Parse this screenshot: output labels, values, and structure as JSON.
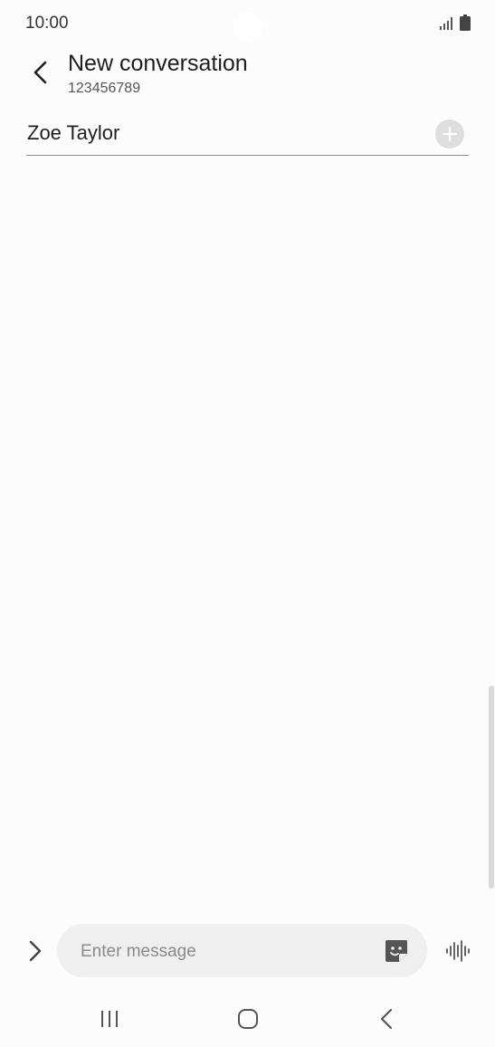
{
  "status_bar": {
    "time": "10:00",
    "signal_icon": "signal-icon",
    "battery_icon": "battery-icon"
  },
  "header": {
    "back_icon": "back-arrow-icon",
    "title": "New conversation",
    "subtitle": "123456789"
  },
  "recipient": {
    "name": "Zoe Taylor",
    "add_icon": "add-icon"
  },
  "composer": {
    "expand_icon": "chevron-right-icon",
    "message_placeholder": "Enter message",
    "message_value": "",
    "sticker_icon": "sticker-icon",
    "voice_icon": "voice-wave-icon"
  },
  "navigation": {
    "recent_icon": "recent-apps-icon",
    "home_icon": "home-icon",
    "back_icon": "nav-back-icon"
  },
  "colors": {
    "background": "#fcfcfc",
    "input_background": "#efefef",
    "add_button": "#dedede",
    "divider": "#8e8e8e",
    "icon": "#555555"
  }
}
